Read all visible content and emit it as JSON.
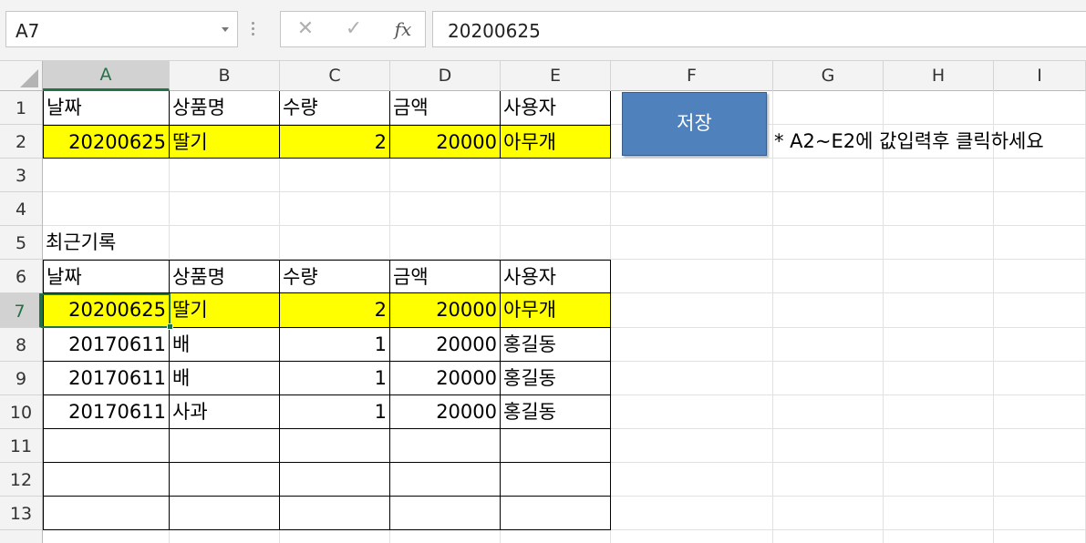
{
  "formula_bar": {
    "name_box": "A7",
    "cancel_icon": "✕",
    "enter_icon": "✓",
    "fx_label": "fx",
    "value": "20200625"
  },
  "columns": [
    "A",
    "B",
    "C",
    "D",
    "E",
    "F",
    "G",
    "H",
    "I"
  ],
  "rows": [
    "1",
    "2",
    "3",
    "4",
    "5",
    "6",
    "7",
    "8",
    "9",
    "10",
    "11",
    "12",
    "13"
  ],
  "input_table": {
    "headers": [
      "날짜",
      "상품명",
      "수량",
      "금액",
      "사용자"
    ],
    "row": [
      "20200625",
      "딸기",
      "2",
      "20000",
      "아무개"
    ]
  },
  "recent_label": "최근기록",
  "recent_table": {
    "headers": [
      "날짜",
      "상품명",
      "수량",
      "금액",
      "사용자"
    ],
    "rows": [
      [
        "20200625",
        "딸기",
        "2",
        "20000",
        "아무개"
      ],
      [
        "20170611",
        "배",
        "1",
        "20000",
        "홍길동"
      ],
      [
        "20170611",
        "배",
        "1",
        "20000",
        "홍길동"
      ],
      [
        "20170611",
        "사과",
        "1",
        "20000",
        "홍길동"
      ]
    ]
  },
  "save_button": "저장",
  "note": "* A2~E2에 값입력후 클릭하세요",
  "colors": {
    "highlight": "#ffff00",
    "button": "#4f81bd",
    "selection": "#217346"
  }
}
